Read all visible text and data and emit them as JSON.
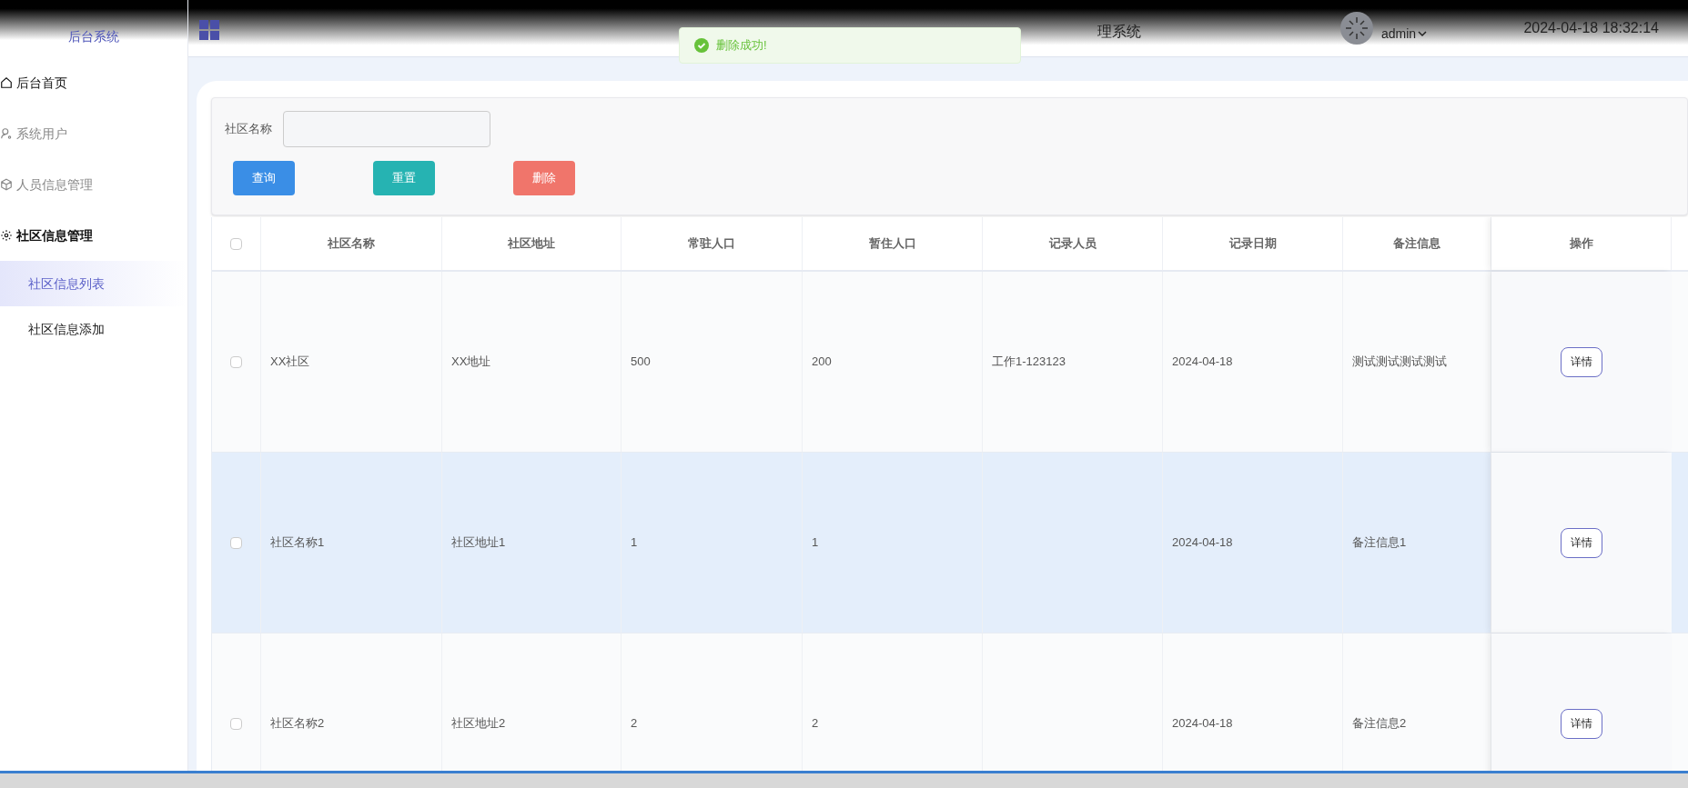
{
  "sidebar": {
    "title": "后台系统",
    "items": [
      {
        "label": "后台首页",
        "expanded": false
      },
      {
        "label": "系统用户",
        "expanded": false
      },
      {
        "label": "人员信息管理",
        "expanded": false
      },
      {
        "label": "社区信息管理",
        "expanded": true,
        "children": [
          {
            "label": "社区信息列表",
            "selected": true
          },
          {
            "label": "社区信息添加",
            "selected": false
          }
        ]
      }
    ]
  },
  "header": {
    "title": "理系统",
    "user": "admin",
    "datetime": "2024-04-18 18:32:14"
  },
  "toast": {
    "message": "删除成功!"
  },
  "filter": {
    "label": "社区名称",
    "buttons": [
      {
        "label": "查询",
        "kind": "primary"
      },
      {
        "label": "重置",
        "kind": "reset"
      },
      {
        "label": "删除",
        "kind": "danger"
      }
    ]
  },
  "table": {
    "header_checked": false,
    "columns": [
      "社区名称",
      "社区地址",
      "常驻人口",
      "暂住人口",
      "记录人员",
      "记录日期",
      "备注信息",
      "操作"
    ],
    "rows": [
      {
        "checked": false,
        "selected": false,
        "cells": [
          "XX社区",
          "XX地址",
          "500",
          "200",
          "工作1-123123",
          "2024-04-18",
          "测试测试测试测试"
        ],
        "action": "详情"
      },
      {
        "checked": false,
        "selected": true,
        "cells": [
          "社区名称1",
          "社区地址1",
          "1",
          "1",
          "",
          "2024-04-18",
          "备注信息1"
        ],
        "action": "详情"
      },
      {
        "checked": false,
        "selected": false,
        "cells": [
          "社区名称2",
          "社区地址2",
          "2",
          "2",
          "",
          "2024-04-18",
          "备注信息2"
        ],
        "action": "详情"
      }
    ]
  }
}
